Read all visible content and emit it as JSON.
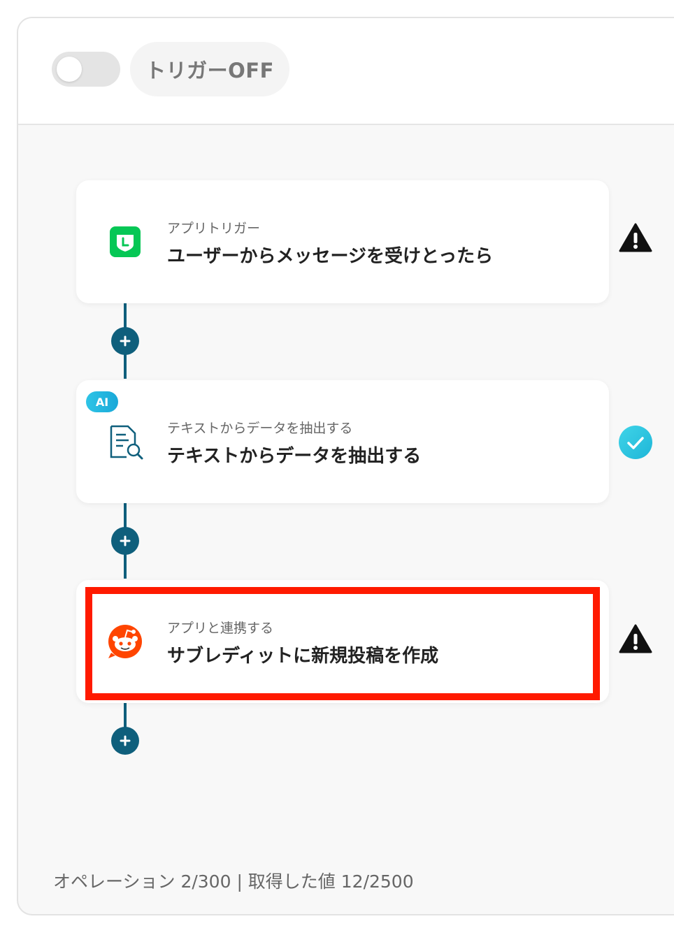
{
  "header": {
    "trigger_state_label": "トリガーOFF",
    "toggle_on": false
  },
  "steps": [
    {
      "subtitle": "アプリトリガー",
      "title": "ユーザーからメッセージを受けとったら",
      "icon": "line-app-icon",
      "status": "warning-icon",
      "badge": ""
    },
    {
      "subtitle": "テキストからデータを抽出する",
      "title": "テキストからデータを抽出する",
      "icon": "document-search-icon",
      "status": "check-icon",
      "badge": "AI"
    },
    {
      "subtitle": "アプリと連携する",
      "title": "サブレディットに新規投稿を作成",
      "icon": "reddit-app-icon",
      "status": "warning-icon",
      "badge": ""
    }
  ],
  "footer": {
    "usage_text": "オペレーション 2/300 | 取得した値 12/2500"
  },
  "colors": {
    "flow_line": "#0f5f7c",
    "highlight": "#ff1a00",
    "check": "#26c6e0",
    "warning": "#111111",
    "line_green": "#06c755",
    "reddit_orange": "#ff4500"
  }
}
